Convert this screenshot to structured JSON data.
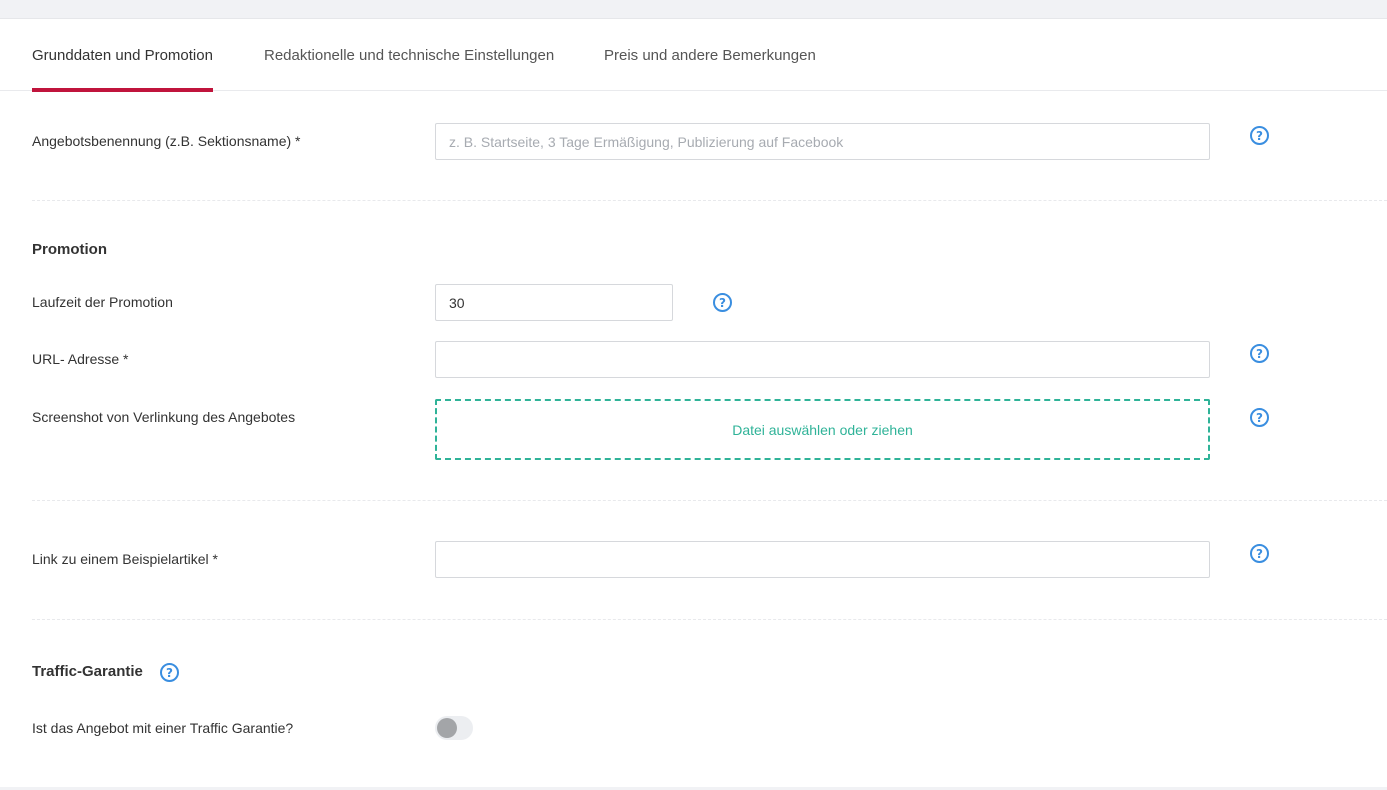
{
  "tabs": [
    {
      "label": "Grunddaten und Promotion"
    },
    {
      "label": "Redaktionelle und technische Einstellungen"
    },
    {
      "label": "Preis und andere Bemerkungen"
    }
  ],
  "offer_name": {
    "label": "Angebotsbenennung (z.B. Sektionsname) *",
    "value": "",
    "placeholder": "z. B. Startseite, 3 Tage Ermäßigung, Publizierung auf Facebook"
  },
  "promotion": {
    "heading": "Promotion",
    "duration_label": "Laufzeit der Promotion",
    "duration_value": "30",
    "url_label": "URL- Adresse *",
    "url_value": "",
    "screenshot_label": "Screenshot von Verlinkung des Angebotes",
    "dropzone_text": "Datei auswählen oder ziehen"
  },
  "example_link": {
    "label": "Link zu einem Beispielartikel *",
    "value": ""
  },
  "traffic": {
    "heading": "Traffic-Garantie",
    "question": "Ist das Angebot mit einer Traffic Garantie?",
    "toggle_on": false
  },
  "help_glyph": "?",
  "colors": {
    "accent": "#c0143c",
    "help_icon": "#3a8ee0",
    "dropzone": "#2fb398"
  }
}
